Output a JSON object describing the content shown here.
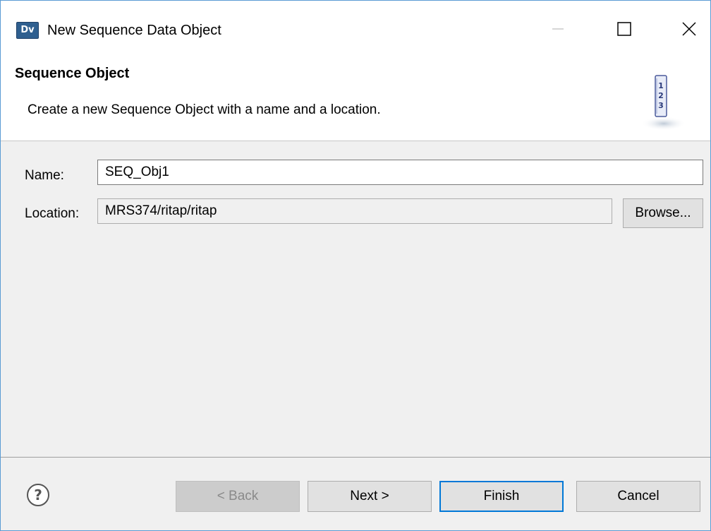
{
  "window": {
    "title": "New Sequence Data Object",
    "app_icon_text": "Dv",
    "controls": [
      "minimize-icon",
      "maximize-icon",
      "close-icon"
    ]
  },
  "header": {
    "title": "Sequence Object",
    "description": "Create a new Sequence Object with a name and a location.",
    "banner_icon": "sequence-number-icon",
    "banner_icon_digits": [
      "1",
      "2",
      "3"
    ]
  },
  "form": {
    "name_label": "Name:",
    "name_value": "SEQ_Obj1",
    "location_label": "Location:",
    "location_value": "MRS374/ritap/ritap",
    "browse_label": "Browse..."
  },
  "footer": {
    "help_icon": "help-icon",
    "back_label": "< Back",
    "next_label": "Next >",
    "finish_label": "Finish",
    "cancel_label": "Cancel"
  },
  "colors": {
    "window_border": "#5a9bd4",
    "default_button_border": "#0078d7",
    "dialog_background": "#f0f0f0"
  }
}
